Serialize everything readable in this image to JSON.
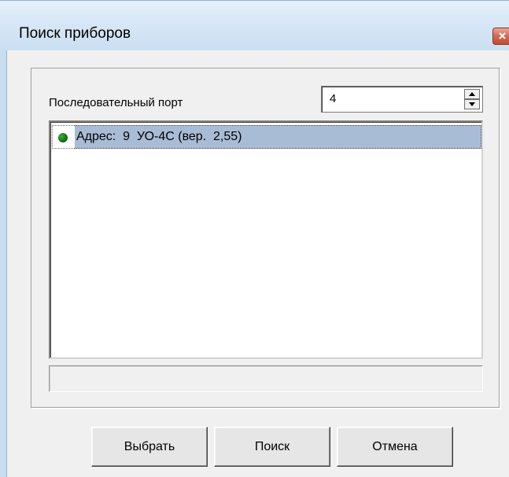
{
  "window": {
    "title": "Поиск приборов"
  },
  "port": {
    "label": "Последовательный порт",
    "value": "4"
  },
  "device_list": {
    "items": [
      {
        "text": "Адрес:  9  УО-4С (вер.  2,55)",
        "status_color": "#117711",
        "selected": true
      }
    ]
  },
  "buttons": {
    "select_label": "Выбрать",
    "search_label": "Поиск",
    "cancel_label": "Отмена"
  },
  "icons": {
    "close": "close-icon",
    "spin_up": "arrow-up-icon",
    "spin_down": "arrow-down-icon",
    "status": "status-dot-icon"
  },
  "colors": {
    "selection": "#a8bcd6",
    "window_background": "#f0f0f0",
    "titlebar": "#d7e7f6",
    "close_button": "#c24c33"
  }
}
